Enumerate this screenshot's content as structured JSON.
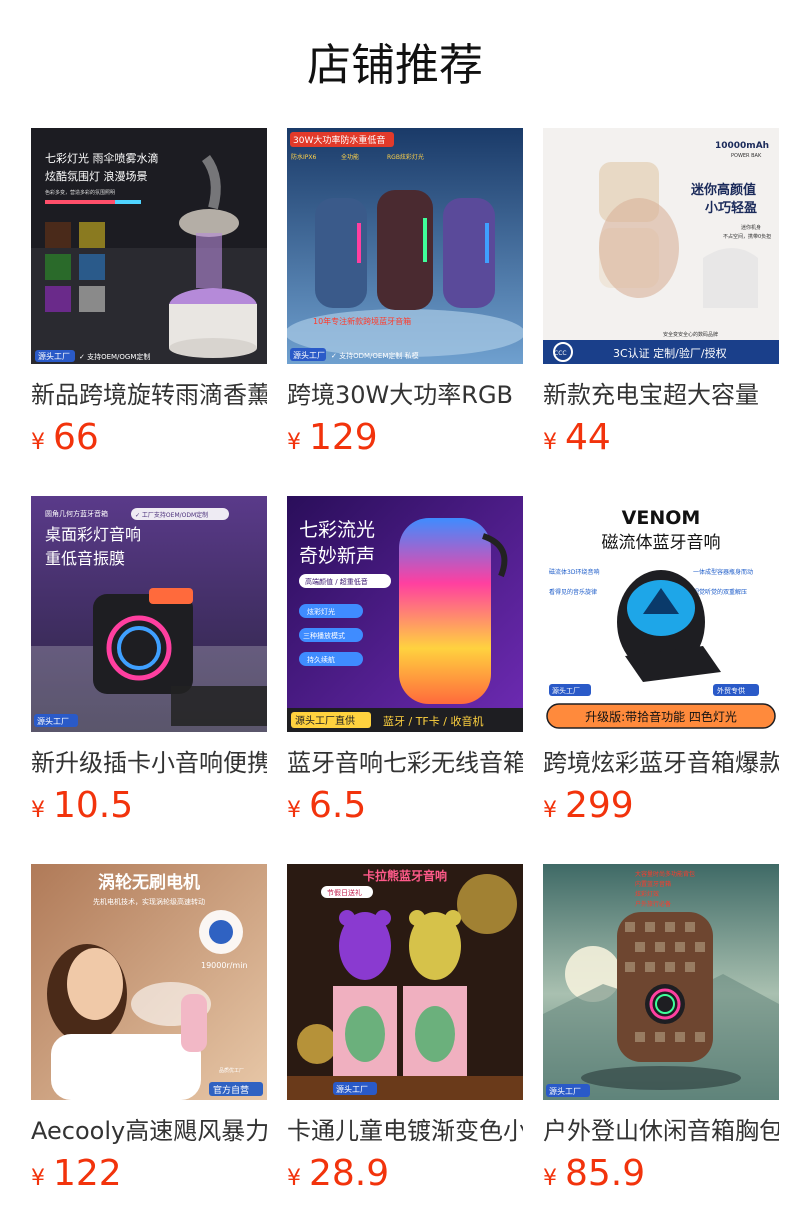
{
  "page": {
    "title": "店铺推荐"
  },
  "currency_symbol": "¥",
  "products": [
    {
      "name": "新品跨境旋转雨滴香薰",
      "price": "66",
      "image": {
        "lines": [
          "七彩灯光 雨伞喷雾水滴",
          "炫酷氛围灯 浪漫场景",
          "色彩多变，营造多彩的氛围照明"
        ],
        "badge": "源头工厂",
        "tag": "✓ 支持OEM/OGM定制",
        "colors": [
          "#1c1c22",
          "#e9e6e2",
          "#b58ad9"
        ]
      }
    },
    {
      "name": "跨境30W大功率RGB",
      "price": "129",
      "image": {
        "lines": [
          "30W大功率防水重低音",
          "防水IPX6",
          "全功能",
          "RGB炫彩灯光",
          "10年专注新款跨境蓝牙音箱"
        ],
        "badge": "源头工厂",
        "tag": "✓ 支持ODM/OEM定制 私模",
        "colors": [
          "#1a4a78",
          "#5f8fbf",
          "#3a2a2a"
        ]
      }
    },
    {
      "name": "新款充电宝超大容量",
      "price": "44",
      "image": {
        "lines": [
          "10000mAh",
          "POWER BAK",
          "迷你高颜值",
          "小巧轻盈",
          "迷你机身",
          "不占空间，携带0负担",
          "安全变安全心的数码品牌"
        ],
        "badge": "3C认证 定制/验厂/授权",
        "tag": "CCC",
        "colors": [
          "#f3f1ef",
          "#e8d9c5",
          "#1a3f8a"
        ]
      }
    },
    {
      "name": "新升级插卡小音响便携",
      "price": "10.5",
      "image": {
        "lines": [
          "圆角几何方蓝牙音箱",
          "✓ 工厂支持OEM/ODM定制",
          "桌面彩灯音响",
          "重低音振膜"
        ],
        "badge": "源头工厂",
        "tag": "",
        "colors": [
          "#4a2f7a",
          "#2a2440",
          "#ff6a3c"
        ]
      }
    },
    {
      "name": "蓝牙音响七彩无线音箱",
      "price": "6.5",
      "image": {
        "lines": [
          "七彩流光",
          "奇妙新声",
          "高端颜值 / 超重低音",
          "炫彩灯光",
          "三种播放模式",
          "持久续航"
        ],
        "badge": "源头工厂直供",
        "tag": "蓝牙 / TF卡 / 收音机",
        "colors": [
          "#3a1670",
          "#6f2bb5",
          "#ff3fa0"
        ]
      }
    },
    {
      "name": "跨境炫彩蓝牙音箱爆款",
      "price": "299",
      "image": {
        "lines": [
          "VENOM",
          "磁流体蓝牙音响",
          "磁流体3D环绕音响",
          "一体成型容器瓶身而动",
          "看得见的音乐旋律",
          "视觉听觉的双重解压"
        ],
        "badge": "源头工厂",
        "tag": "外贸专供",
        "extra": "升级版:带拾音功能 四色灯光",
        "colors": [
          "#ffffff",
          "#1e1e22",
          "#1ea6e8"
        ]
      }
    },
    {
      "name": "Aecooly高速飓风暴力涡轮",
      "price": "122",
      "image": {
        "lines": [
          "涡轮无刷电机",
          "先机电机技术，实现涡轮级高速转动",
          "19000r/min",
          "品质优工厂"
        ],
        "badge": "官方自营",
        "tag": "",
        "colors": [
          "#c99a7a",
          "#8a6248",
          "#2f62c2"
        ]
      }
    },
    {
      "name": "卡通儿童电镀渐变色小熊",
      "price": "28.9",
      "image": {
        "lines": [
          "卡拉熊蓝牙音响",
          "节假日送礼"
        ],
        "badge": "源头工厂",
        "tag": "",
        "colors": [
          "#2a1a12",
          "#f2c64a",
          "#8a3ad0"
        ]
      }
    },
    {
      "name": "户外登山休闲音箱胸包",
      "price": "85.9",
      "image": {
        "lines": [
          "大容量时尚多功能背包",
          "内置蓝牙音箱",
          "炫彩灯效",
          "户外旅行必备"
        ],
        "badge": "源头工厂",
        "tag": "",
        "colors": [
          "#4f7a72",
          "#6e4630",
          "#e8e0c0"
        ]
      }
    }
  ]
}
